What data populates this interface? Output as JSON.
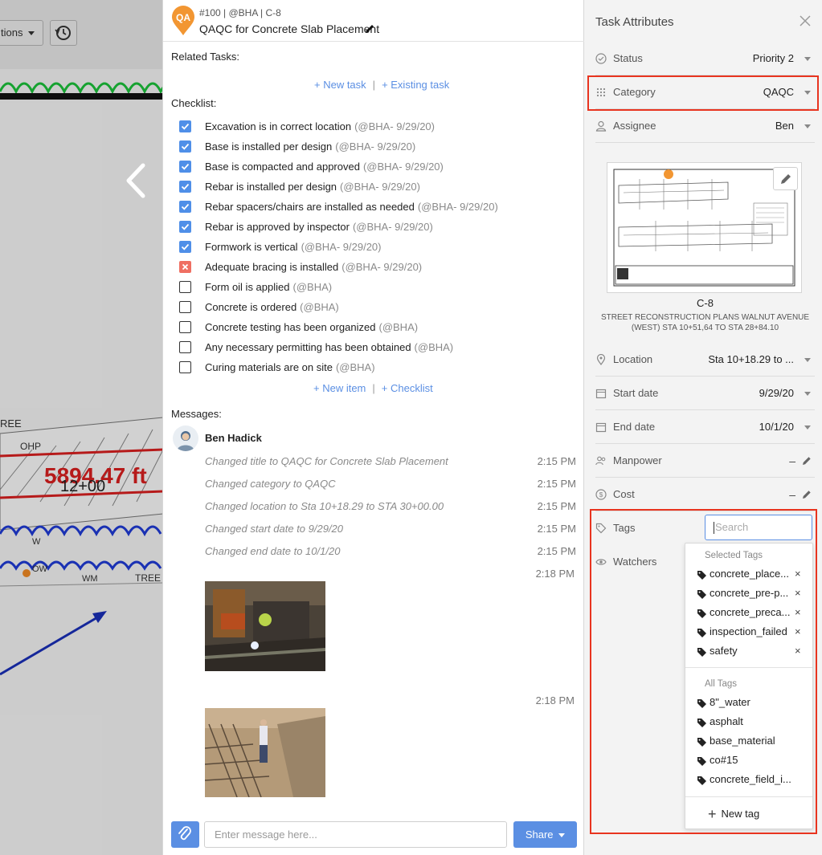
{
  "background": {
    "options_button": "tions",
    "history_button": "history",
    "drawing_texts": [
      "REE",
      "OHP",
      "5894.47 ft",
      "12+00",
      "W",
      "OW",
      "WM",
      "TREE"
    ]
  },
  "task": {
    "id_line": "#100 | @BHA | C-8",
    "pin_label": "QA",
    "title": "QAQC for Concrete Slab Placement",
    "related_label": "Related Tasks:",
    "new_task": "+ New task",
    "link_sep": "|",
    "existing_task": "+ Existing task",
    "checklist_label": "Checklist:",
    "checklist": [
      {
        "text": "Excavation is in correct location",
        "meta": "(@BHA- 9/29/20)",
        "state": "checked"
      },
      {
        "text": "Base is installed per design",
        "meta": "(@BHA- 9/29/20)",
        "state": "checked"
      },
      {
        "text": "Base is compacted and approved",
        "meta": "(@BHA- 9/29/20)",
        "state": "checked"
      },
      {
        "text": "Rebar is installed per design",
        "meta": "(@BHA- 9/29/20)",
        "state": "checked"
      },
      {
        "text": "Rebar spacers/chairs are installed as needed",
        "meta": "(@BHA- 9/29/20)",
        "state": "checked"
      },
      {
        "text": "Rebar is approved by inspector",
        "meta": "(@BHA- 9/29/20)",
        "state": "checked"
      },
      {
        "text": "Formwork is vertical",
        "meta": "(@BHA- 9/29/20)",
        "state": "checked"
      },
      {
        "text": "Adequate bracing is installed",
        "meta": "(@BHA- 9/29/20)",
        "state": "failed"
      },
      {
        "text": "Form oil is applied",
        "meta": "(@BHA)",
        "state": "unchecked"
      },
      {
        "text": "Concrete is ordered",
        "meta": "(@BHA)",
        "state": "unchecked"
      },
      {
        "text": "Concrete testing has been organized",
        "meta": "(@BHA)",
        "state": "unchecked"
      },
      {
        "text": "Any necessary permitting has been obtained",
        "meta": "(@BHA)",
        "state": "unchecked"
      },
      {
        "text": "Curing materials are on site",
        "meta": "(@BHA)",
        "state": "unchecked"
      }
    ],
    "new_item": "+ New item",
    "new_checklist": "+ Checklist",
    "messages_label": "Messages:",
    "author": "Ben Hadick",
    "activity": [
      {
        "text": "Changed title to QAQC for Concrete Slab Placement",
        "time": "2:15 PM"
      },
      {
        "text": "Changed category to QAQC",
        "time": "2:15 PM"
      },
      {
        "text": "Changed location to Sta 10+18.29 to STA 30+00.00",
        "time": "2:15 PM"
      },
      {
        "text": "Changed start date to 9/29/20",
        "time": "2:15 PM"
      },
      {
        "text": "Changed end date to 10/1/20",
        "time": "2:15 PM"
      }
    ],
    "photo_times": [
      "2:18 PM",
      "2:18 PM"
    ],
    "composer_placeholder": "Enter message here...",
    "share_label": "Share"
  },
  "attributes": {
    "title": "Task Attributes",
    "status_label": "Status",
    "status_value": "Priority 2",
    "category_label": "Category",
    "category_value": "QAQC",
    "assignee_label": "Assignee",
    "assignee_value": "Ben",
    "sheet_name": "C-8",
    "sheet_desc": "STREET RECONSTRUCTION PLANS WALNUT AVENUE (WEST) STA 10+51,64 TO STA 28+84.10",
    "location_label": "Location",
    "location_value": "Sta 10+18.29 to ...",
    "start_label": "Start date",
    "start_value": "9/29/20",
    "end_label": "End date",
    "end_value": "10/1/20",
    "manpower_label": "Manpower",
    "manpower_value": "–",
    "cost_label": "Cost",
    "cost_value": "–",
    "tags_label": "Tags",
    "tags_search_placeholder": "Search",
    "watchers_label": "Watchers",
    "selected_tags_label": "Selected Tags",
    "selected_tags": [
      "concrete_place...",
      "concrete_pre-p...",
      "concrete_preca...",
      "inspection_failed",
      "safety"
    ],
    "remove_glyph": "×",
    "all_tags_label": "All Tags",
    "all_tags": [
      "8\"_water",
      "asphalt",
      "base_material",
      "co#15",
      "concrete_field_i..."
    ],
    "new_tag_label": "New tag",
    "highlight_color": "#e8341f",
    "accent_color": "#5b8fe3"
  }
}
